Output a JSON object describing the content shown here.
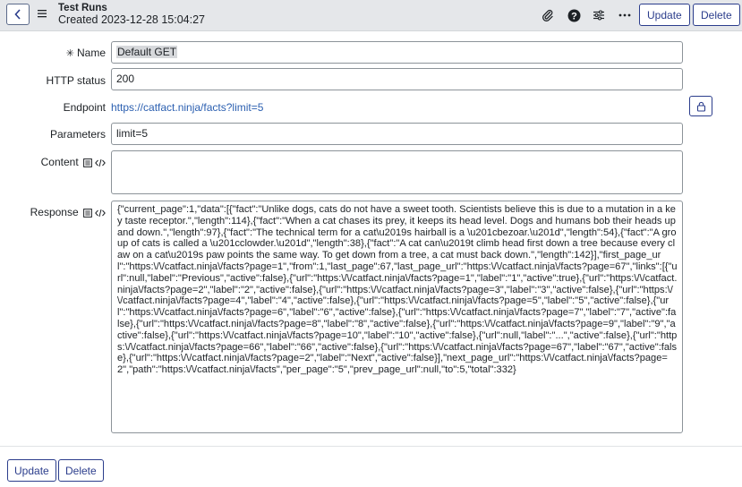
{
  "header": {
    "title": "Test Runs",
    "subtitle": "Created 2023-12-28 15:04:27",
    "update_label": "Update",
    "delete_label": "Delete"
  },
  "form": {
    "name_label": "Name",
    "name_value": "Default GET",
    "http_status_label": "HTTP status",
    "http_status_value": "200",
    "endpoint_label": "Endpoint",
    "endpoint_value": "https://catfact.ninja/facts?limit=5",
    "parameters_label": "Parameters",
    "parameters_value": "limit=5",
    "content_label": "Content",
    "content_value": "",
    "response_label": "Response",
    "response_value": "{\"current_page\":1,\"data\":[{\"fact\":\"Unlike dogs, cats do not have a sweet tooth. Scientists believe this is due to a mutation in a key taste receptor.\",\"length\":114},{\"fact\":\"When a cat chases its prey, it keeps its head level. Dogs and humans bob their heads up and down.\",\"length\":97},{\"fact\":\"The technical term for a cat\\u2019s hairball is a \\u201cbezoar.\\u201d\",\"length\":54},{\"fact\":\"A group of cats is called a \\u201cclowder.\\u201d\",\"length\":38},{\"fact\":\"A cat can\\u2019t climb head first down a tree because every claw on a cat\\u2019s paw points the same way. To get down from a tree, a cat must back down.\",\"length\":142}],\"first_page_url\":\"https:\\/\\/catfact.ninja\\/facts?page=1\",\"from\":1,\"last_page\":67,\"last_page_url\":\"https:\\/\\/catfact.ninja\\/facts?page=67\",\"links\":[{\"url\":null,\"label\":\"Previous\",\"active\":false},{\"url\":\"https:\\/\\/catfact.ninja\\/facts?page=1\",\"label\":\"1\",\"active\":true},{\"url\":\"https:\\/\\/catfact.ninja\\/facts?page=2\",\"label\":\"2\",\"active\":false},{\"url\":\"https:\\/\\/catfact.ninja\\/facts?page=3\",\"label\":\"3\",\"active\":false},{\"url\":\"https:\\/\\/catfact.ninja\\/facts?page=4\",\"label\":\"4\",\"active\":false},{\"url\":\"https:\\/\\/catfact.ninja\\/facts?page=5\",\"label\":\"5\",\"active\":false},{\"url\":\"https:\\/\\/catfact.ninja\\/facts?page=6\",\"label\":\"6\",\"active\":false},{\"url\":\"https:\\/\\/catfact.ninja\\/facts?page=7\",\"label\":\"7\",\"active\":false},{\"url\":\"https:\\/\\/catfact.ninja\\/facts?page=8\",\"label\":\"8\",\"active\":false},{\"url\":\"https:\\/\\/catfact.ninja\\/facts?page=9\",\"label\":\"9\",\"active\":false},{\"url\":\"https:\\/\\/catfact.ninja\\/facts?page=10\",\"label\":\"10\",\"active\":false},{\"url\":null,\"label\":\"...\",\"active\":false},{\"url\":\"https:\\/\\/catfact.ninja\\/facts?page=66\",\"label\":\"66\",\"active\":false},{\"url\":\"https:\\/\\/catfact.ninja\\/facts?page=67\",\"label\":\"67\",\"active\":false},{\"url\":\"https:\\/\\/catfact.ninja\\/facts?page=2\",\"label\":\"Next\",\"active\":false}],\"next_page_url\":\"https:\\/\\/catfact.ninja\\/facts?page=2\",\"path\":\"https:\\/\\/catfact.ninja\\/facts\",\"per_page\":\"5\",\"prev_page_url\":null,\"to\":5,\"total\":332}"
  },
  "footer": {
    "update_label": "Update",
    "delete_label": "Delete"
  },
  "icons": {
    "back": "chevron-left-icon",
    "menu": "hamburger-menu-icon",
    "attachment": "paperclip-icon",
    "help": "question-circle-icon",
    "settings": "sliders-icon",
    "more": "ellipsis-icon",
    "lock": "lock-icon",
    "script": "document-icon",
    "code": "code-icon"
  },
  "colors": {
    "accent": "#2b3d8c",
    "link": "#2b5fb0",
    "header_bg": "#e5e7ea"
  }
}
